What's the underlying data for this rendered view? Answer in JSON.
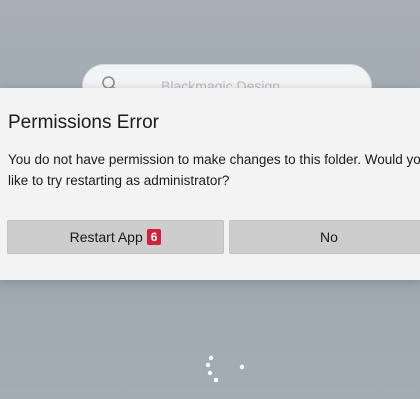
{
  "background": {
    "search": {
      "placeholder": "Blackmagic Design"
    }
  },
  "dialog": {
    "title": "Permissions Error",
    "message": "You do not have permission to make changes to this folder. Would you like to try restarting as administrator?",
    "buttons": {
      "restart_label": "Restart App",
      "restart_badge": "6",
      "no_label": "No"
    }
  },
  "colors": {
    "badge": "#d6203a",
    "button": "#cdcdcd",
    "dialog_background": "#f3f3f3"
  },
  "icons": {
    "search": "search-icon",
    "loading": "loading-spinner-icon"
  }
}
